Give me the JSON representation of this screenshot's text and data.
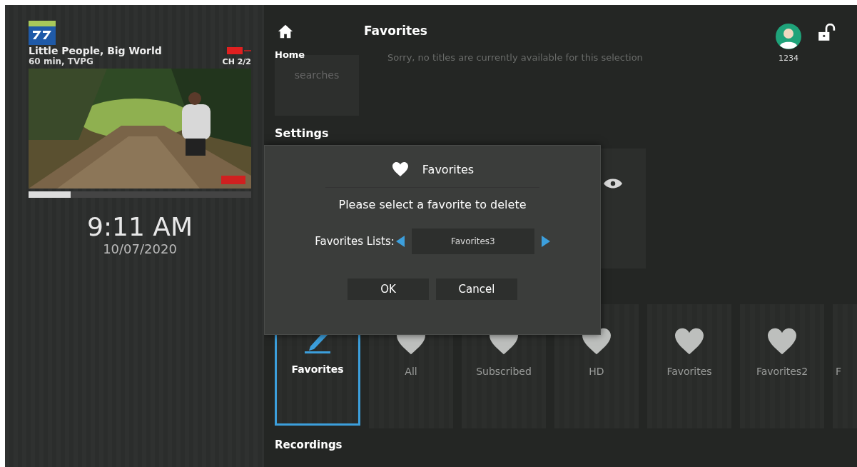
{
  "now_playing": {
    "title": "Little People, Big World",
    "details": "60 min, TVPG",
    "channel": "CH 2/2",
    "progress": {
      "level": 0.19
    }
  },
  "clock": {
    "time": "9:11 AM",
    "date": "10/07/2020"
  },
  "header": {
    "home_label": "Home",
    "title": "Favorites",
    "user": "1234"
  },
  "background": {
    "recent_label": "searches",
    "notice": "Sorry, no titles are currently available for this selection"
  },
  "sections": [
    {
      "title": "Settings"
    }
  ],
  "favorites_row": [
    {
      "label": "Favorites",
      "kind": "edit",
      "selected": true
    },
    {
      "label": "All",
      "kind": "list",
      "selected": false
    },
    {
      "label": "Subscribed",
      "kind": "list",
      "selected": false
    },
    {
      "label": "HD",
      "kind": "list",
      "selected": false
    },
    {
      "label": "Favorites",
      "kind": "list",
      "selected": false
    },
    {
      "label": "Favorites2",
      "kind": "list",
      "selected": false
    },
    {
      "label": "F",
      "kind": "partial",
      "selected": false
    }
  ],
  "recordings_title": "Recordings",
  "dialog": {
    "title": "Favorites",
    "message": "Please select a favorite to delete",
    "picker_label": "Favorites Lists:",
    "picker_value": "Favorites3",
    "buttons": [
      {
        "label": "OK",
        "selected": false
      },
      {
        "label": "Cancel",
        "selected": false
      }
    ]
  }
}
